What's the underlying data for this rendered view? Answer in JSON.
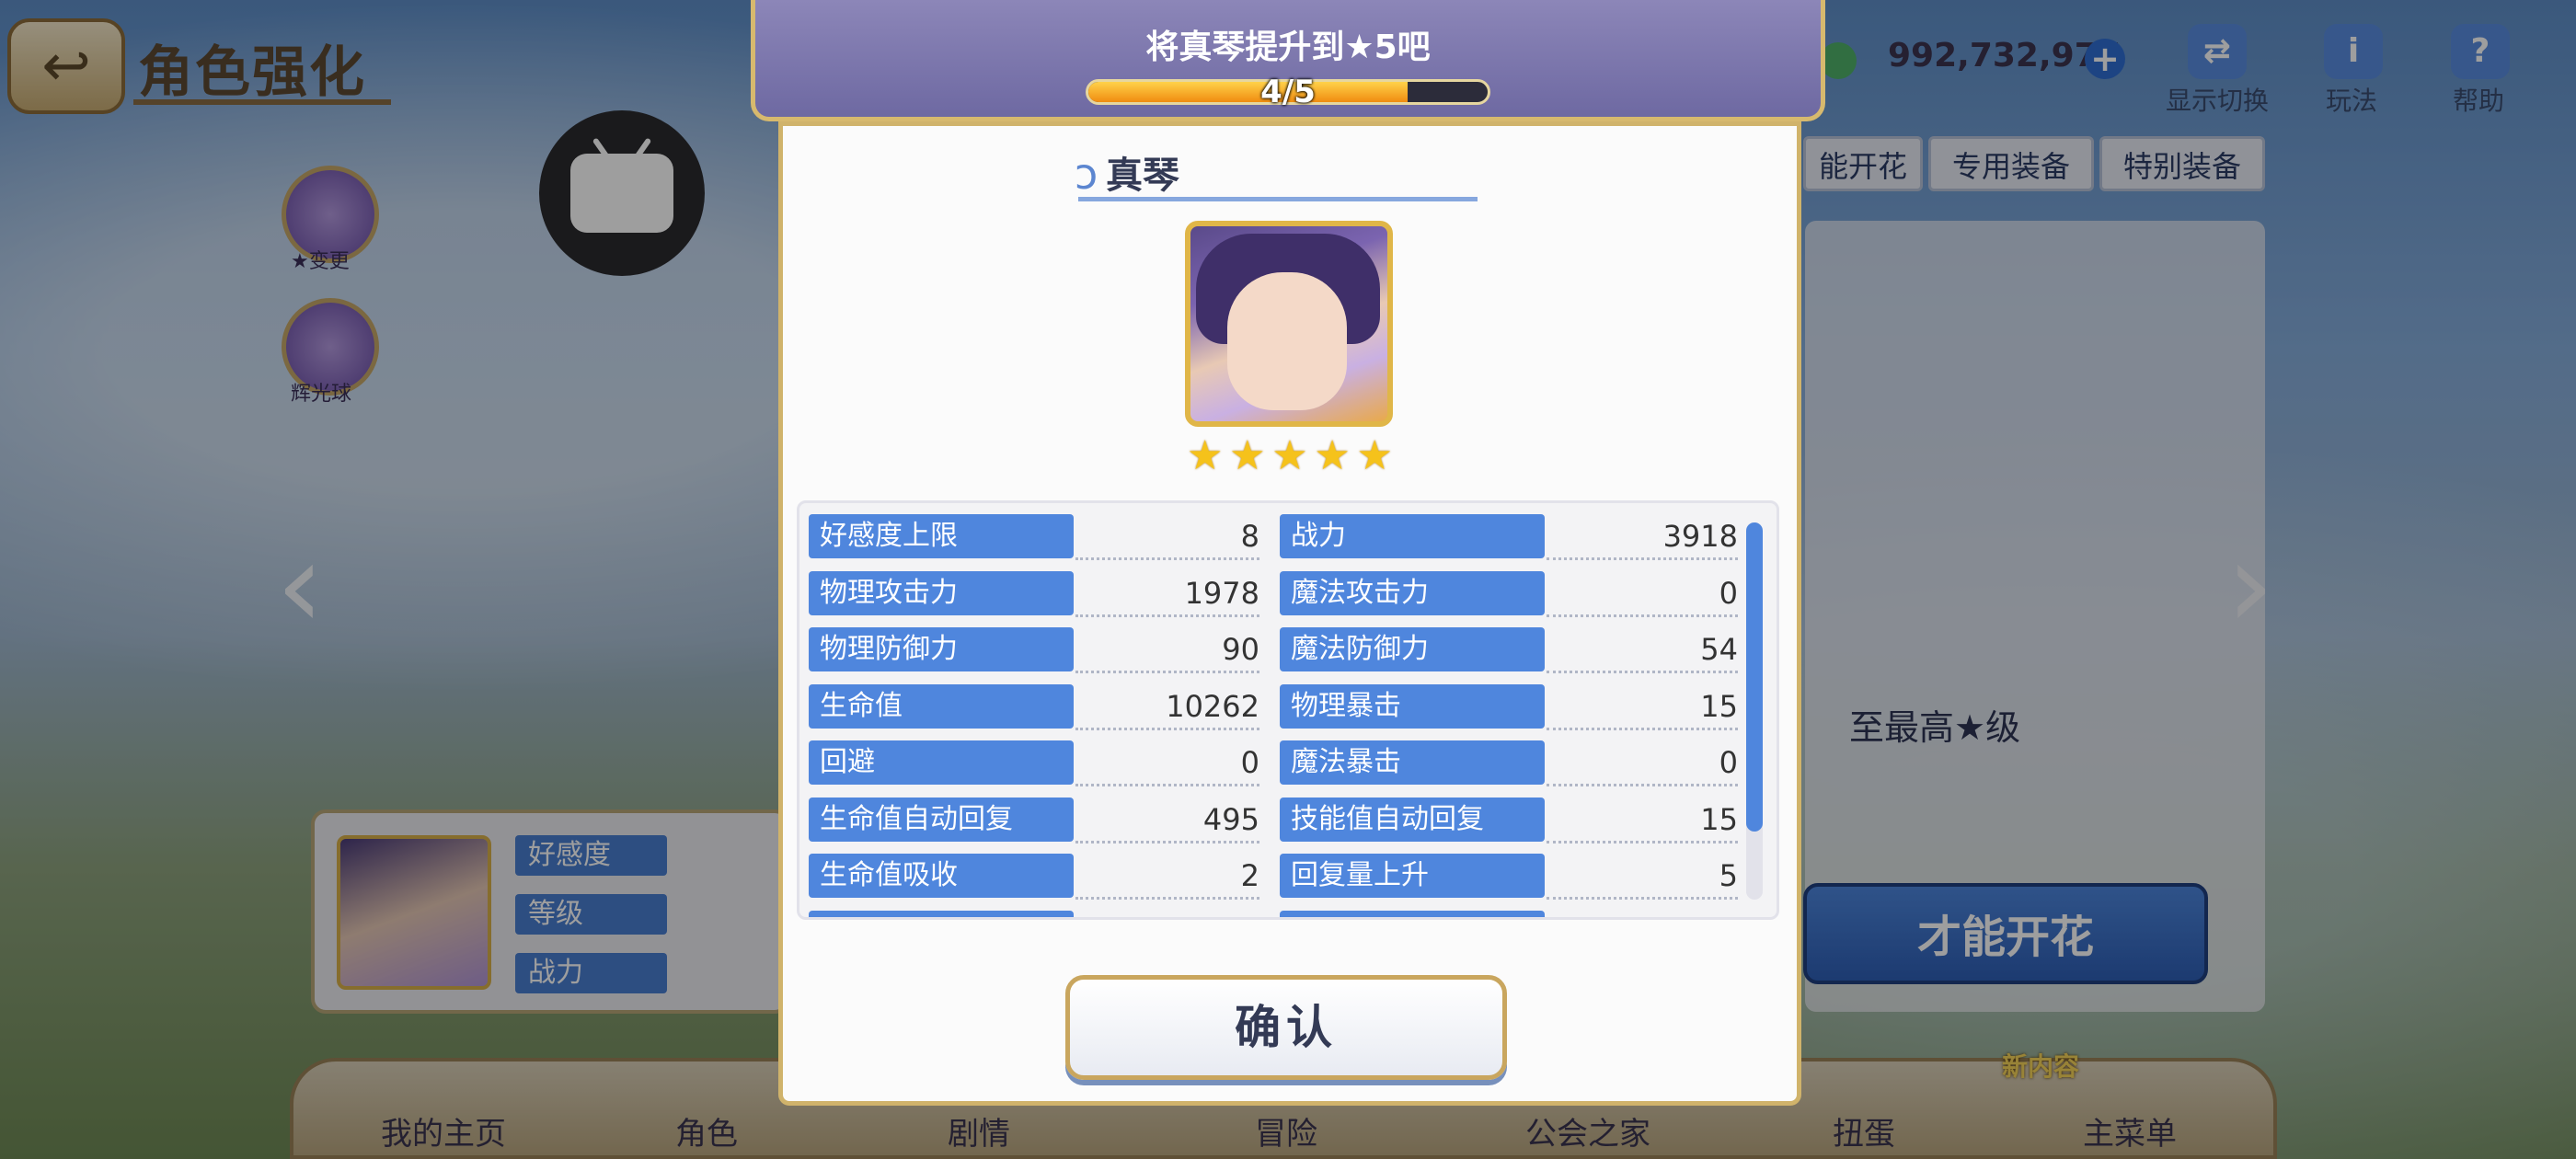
{
  "screen": {
    "title": "角色强化"
  },
  "side_buttons": [
    {
      "label": "★变更"
    },
    {
      "label": "辉光球"
    }
  ],
  "currency": {
    "amount": "992,732,977"
  },
  "top_buttons": [
    {
      "label": "显示切换"
    },
    {
      "label": "玩法"
    },
    {
      "label": "帮助"
    }
  ],
  "tabs": [
    {
      "label": "能开花"
    },
    {
      "label": "专用装备"
    },
    {
      "label": "特别装备"
    }
  ],
  "background_text": {
    "max_star_hint": "至最高★级",
    "blossom_button": "才能开花"
  },
  "char_card": {
    "labels": [
      "好感度",
      "等级",
      "战力"
    ]
  },
  "bottom_nav": [
    {
      "label": "我的主页"
    },
    {
      "label": "角色"
    },
    {
      "label": "剧情"
    },
    {
      "label": "冒险"
    },
    {
      "label": "公会之家"
    },
    {
      "label": "扭蛋"
    },
    {
      "label": "主菜单"
    }
  ],
  "new_badge": "新内容",
  "dialog": {
    "header": "将真琴提升到★5吧",
    "progress": {
      "text": "4/5",
      "current": 4,
      "max": 5
    },
    "character_name": "真琴",
    "star_count": 5,
    "stats": [
      {
        "label": "好感度上限",
        "value": "8"
      },
      {
        "label": "战力",
        "value": "3918"
      },
      {
        "label": "物理攻击力",
        "value": "1978"
      },
      {
        "label": "魔法攻击力",
        "value": "0"
      },
      {
        "label": "物理防御力",
        "value": "90"
      },
      {
        "label": "魔法防御力",
        "value": "54"
      },
      {
        "label": "生命值",
        "value": "10262"
      },
      {
        "label": "物理暴击",
        "value": "15"
      },
      {
        "label": "回避",
        "value": "0"
      },
      {
        "label": "魔法暴击",
        "value": "0"
      },
      {
        "label": "生命值自动回复",
        "value": "495"
      },
      {
        "label": "技能值自动回复",
        "value": "15"
      },
      {
        "label": "生命值吸收",
        "value": "2"
      },
      {
        "label": "回复量上升",
        "value": "5"
      }
    ],
    "confirm_label": "确认"
  },
  "colors": {
    "accent": "#4f86dd",
    "gold": "#d0b36b",
    "header": "#7a75ad"
  }
}
